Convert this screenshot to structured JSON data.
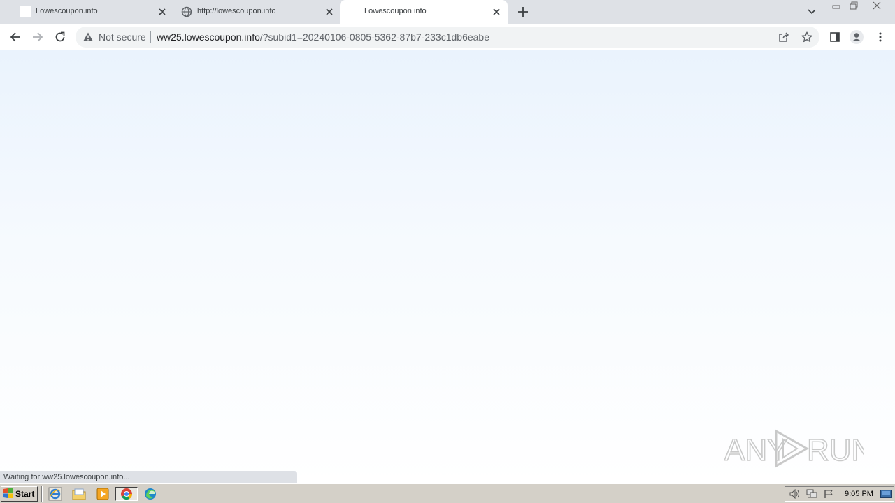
{
  "tabs": [
    {
      "title": "Lowescoupon.info",
      "favicon": "blank-page-icon",
      "active": false
    },
    {
      "title": "http://lowescoupon.info",
      "favicon": "globe-icon",
      "active": false
    },
    {
      "title": "Lowescoupon.info",
      "favicon": "none",
      "active": true
    }
  ],
  "toolbar": {
    "security_text": "Not secure",
    "url_host": "ww25.lowescoupon.info",
    "url_rest": "/?subid1=20240106-0805-5362-87b7-233c1db6eabe"
  },
  "status": {
    "text": "Waiting for ww25.lowescoupon.info..."
  },
  "watermark": {
    "text_left": "ANY",
    "text_right": "RUN"
  },
  "taskbar": {
    "start_label": "Start",
    "clock": "9:05 PM"
  },
  "colors": {
    "tabstrip": "#dee1e6",
    "content_top": "#eaf3fd",
    "content_bottom": "#ffffff",
    "taskbar": "#d4d0c8"
  }
}
